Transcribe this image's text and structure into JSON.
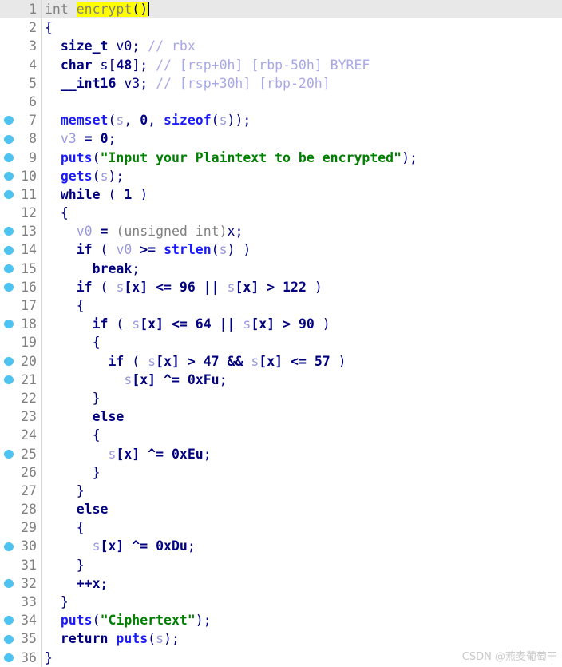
{
  "app": {
    "view": "pseudocode-decompiler",
    "function_name": "encrypt",
    "highlighted_identifier": "encrypt",
    "highlight_color": "#ffff00",
    "current_line_color": "#e8e8e8",
    "breakpoint_dot_color": "#4cc3f0",
    "gutter_divider_color": "#d8d8d8",
    "background_color": "#ffffff"
  },
  "watermark": {
    "text": "CSDN @燕麦葡萄干"
  },
  "colors": {
    "keyword": "#000080",
    "function": "#1a1aff",
    "variable": "#9a9ae0",
    "string": "#008000",
    "comment": "#a8a8e8",
    "cast_type": "#808080",
    "line_number": "#808080"
  },
  "editor": {
    "total_lines": 36,
    "current_line": 1,
    "breakpoint_lines": [
      7,
      8,
      9,
      10,
      11,
      13,
      14,
      15,
      16,
      18,
      20,
      21,
      25,
      30,
      32,
      34,
      35,
      36
    ],
    "lines": [
      {
        "n": "1",
        "dot": false,
        "current": true,
        "tokens": [
          {
            "t": "int ",
            "c": "t-type"
          },
          {
            "t": "encrypt",
            "c": "t-type t-hl"
          },
          {
            "t": "()",
            "c": "t-plain t-hl"
          },
          {
            "t": "",
            "c": "caret"
          }
        ]
      },
      {
        "n": "2",
        "dot": false,
        "tokens": [
          {
            "t": "{",
            "c": "t-plain"
          }
        ]
      },
      {
        "n": "3",
        "dot": false,
        "tokens": [
          {
            "t": "  ",
            "c": "t-plain"
          },
          {
            "t": "size_t",
            "c": "t-kw"
          },
          {
            "t": " v0; ",
            "c": "t-plain"
          },
          {
            "t": "// rbx",
            "c": "t-cmt"
          }
        ]
      },
      {
        "n": "4",
        "dot": false,
        "tokens": [
          {
            "t": "  ",
            "c": "t-plain"
          },
          {
            "t": "char",
            "c": "t-kw"
          },
          {
            "t": " s[",
            "c": "t-plain"
          },
          {
            "t": "48",
            "c": "t-num"
          },
          {
            "t": "]; ",
            "c": "t-plain"
          },
          {
            "t": "// [rsp+0h] [rbp-50h] BYREF",
            "c": "t-cmt"
          }
        ]
      },
      {
        "n": "5",
        "dot": false,
        "tokens": [
          {
            "t": "  ",
            "c": "t-plain"
          },
          {
            "t": "__int16",
            "c": "t-kw"
          },
          {
            "t": " v3; ",
            "c": "t-plain"
          },
          {
            "t": "// [rsp+30h] [rbp-20h]",
            "c": "t-cmt"
          }
        ]
      },
      {
        "n": "6",
        "dot": false,
        "tokens": [
          {
            "t": "",
            "c": "t-plain"
          }
        ]
      },
      {
        "n": "7",
        "dot": true,
        "tokens": [
          {
            "t": "  ",
            "c": "t-plain"
          },
          {
            "t": "memset",
            "c": "t-fn"
          },
          {
            "t": "(",
            "c": "t-plain"
          },
          {
            "t": "s",
            "c": "t-var"
          },
          {
            "t": ", ",
            "c": "t-plain"
          },
          {
            "t": "0",
            "c": "t-num"
          },
          {
            "t": ", ",
            "c": "t-plain"
          },
          {
            "t": "sizeof",
            "c": "t-fn"
          },
          {
            "t": "(",
            "c": "t-plain"
          },
          {
            "t": "s",
            "c": "t-var"
          },
          {
            "t": "));",
            "c": "t-plain"
          }
        ]
      },
      {
        "n": "8",
        "dot": true,
        "tokens": [
          {
            "t": "  ",
            "c": "t-plain"
          },
          {
            "t": "v3",
            "c": "t-var"
          },
          {
            "t": " = ",
            "c": "t-op"
          },
          {
            "t": "0",
            "c": "t-num"
          },
          {
            "t": ";",
            "c": "t-plain"
          }
        ]
      },
      {
        "n": "9",
        "dot": true,
        "tokens": [
          {
            "t": "  ",
            "c": "t-plain"
          },
          {
            "t": "puts",
            "c": "t-fn"
          },
          {
            "t": "(",
            "c": "t-plain"
          },
          {
            "t": "\"Input your Plaintext to be encrypted\"",
            "c": "t-str"
          },
          {
            "t": ");",
            "c": "t-plain"
          }
        ]
      },
      {
        "n": "10",
        "dot": true,
        "tokens": [
          {
            "t": "  ",
            "c": "t-plain"
          },
          {
            "t": "gets",
            "c": "t-fn"
          },
          {
            "t": "(",
            "c": "t-plain"
          },
          {
            "t": "s",
            "c": "t-var"
          },
          {
            "t": ");",
            "c": "t-plain"
          }
        ]
      },
      {
        "n": "11",
        "dot": true,
        "tokens": [
          {
            "t": "  ",
            "c": "t-plain"
          },
          {
            "t": "while",
            "c": "t-kw"
          },
          {
            "t": " ( ",
            "c": "t-plain"
          },
          {
            "t": "1",
            "c": "t-num"
          },
          {
            "t": " )",
            "c": "t-plain"
          }
        ]
      },
      {
        "n": "12",
        "dot": false,
        "tokens": [
          {
            "t": "  {",
            "c": "t-plain"
          }
        ]
      },
      {
        "n": "13",
        "dot": true,
        "tokens": [
          {
            "t": "    ",
            "c": "t-plain"
          },
          {
            "t": "v0",
            "c": "t-var"
          },
          {
            "t": " = ",
            "c": "t-op"
          },
          {
            "t": "(unsigned int)",
            "c": "t-type"
          },
          {
            "t": "x;",
            "c": "t-plain"
          }
        ]
      },
      {
        "n": "14",
        "dot": true,
        "tokens": [
          {
            "t": "    ",
            "c": "t-plain"
          },
          {
            "t": "if",
            "c": "t-kw"
          },
          {
            "t": " ( ",
            "c": "t-plain"
          },
          {
            "t": "v0",
            "c": "t-var"
          },
          {
            "t": " >= ",
            "c": "t-op"
          },
          {
            "t": "strlen",
            "c": "t-fn"
          },
          {
            "t": "(",
            "c": "t-plain"
          },
          {
            "t": "s",
            "c": "t-var"
          },
          {
            "t": ") )",
            "c": "t-plain"
          }
        ]
      },
      {
        "n": "15",
        "dot": true,
        "tokens": [
          {
            "t": "      ",
            "c": "t-plain"
          },
          {
            "t": "break",
            "c": "t-kw"
          },
          {
            "t": ";",
            "c": "t-plain"
          }
        ]
      },
      {
        "n": "16",
        "dot": true,
        "tokens": [
          {
            "t": "    ",
            "c": "t-plain"
          },
          {
            "t": "if",
            "c": "t-kw"
          },
          {
            "t": " ( ",
            "c": "t-plain"
          },
          {
            "t": "s",
            "c": "t-var"
          },
          {
            "t": "[x] <= ",
            "c": "t-op"
          },
          {
            "t": "96",
            "c": "t-num"
          },
          {
            "t": " || ",
            "c": "t-op"
          },
          {
            "t": "s",
            "c": "t-var"
          },
          {
            "t": "[x] > ",
            "c": "t-op"
          },
          {
            "t": "122",
            "c": "t-num"
          },
          {
            "t": " )",
            "c": "t-plain"
          }
        ]
      },
      {
        "n": "17",
        "dot": false,
        "tokens": [
          {
            "t": "    {",
            "c": "t-plain"
          }
        ]
      },
      {
        "n": "18",
        "dot": true,
        "tokens": [
          {
            "t": "      ",
            "c": "t-plain"
          },
          {
            "t": "if",
            "c": "t-kw"
          },
          {
            "t": " ( ",
            "c": "t-plain"
          },
          {
            "t": "s",
            "c": "t-var"
          },
          {
            "t": "[x] <= ",
            "c": "t-op"
          },
          {
            "t": "64",
            "c": "t-num"
          },
          {
            "t": " || ",
            "c": "t-op"
          },
          {
            "t": "s",
            "c": "t-var"
          },
          {
            "t": "[x] > ",
            "c": "t-op"
          },
          {
            "t": "90",
            "c": "t-num"
          },
          {
            "t": " )",
            "c": "t-plain"
          }
        ]
      },
      {
        "n": "19",
        "dot": false,
        "tokens": [
          {
            "t": "      {",
            "c": "t-plain"
          }
        ]
      },
      {
        "n": "20",
        "dot": true,
        "tokens": [
          {
            "t": "        ",
            "c": "t-plain"
          },
          {
            "t": "if",
            "c": "t-kw"
          },
          {
            "t": " ( ",
            "c": "t-plain"
          },
          {
            "t": "s",
            "c": "t-var"
          },
          {
            "t": "[x] > ",
            "c": "t-op"
          },
          {
            "t": "47",
            "c": "t-num"
          },
          {
            "t": " && ",
            "c": "t-op"
          },
          {
            "t": "s",
            "c": "t-var"
          },
          {
            "t": "[x] <= ",
            "c": "t-op"
          },
          {
            "t": "57",
            "c": "t-num"
          },
          {
            "t": " )",
            "c": "t-plain"
          }
        ]
      },
      {
        "n": "21",
        "dot": true,
        "tokens": [
          {
            "t": "          ",
            "c": "t-plain"
          },
          {
            "t": "s",
            "c": "t-var"
          },
          {
            "t": "[x] ^= ",
            "c": "t-op"
          },
          {
            "t": "0xFu",
            "c": "t-num"
          },
          {
            "t": ";",
            "c": "t-plain"
          }
        ]
      },
      {
        "n": "22",
        "dot": false,
        "tokens": [
          {
            "t": "      }",
            "c": "t-plain"
          }
        ]
      },
      {
        "n": "23",
        "dot": false,
        "tokens": [
          {
            "t": "      ",
            "c": "t-plain"
          },
          {
            "t": "else",
            "c": "t-kw"
          }
        ]
      },
      {
        "n": "24",
        "dot": false,
        "tokens": [
          {
            "t": "      {",
            "c": "t-plain"
          }
        ]
      },
      {
        "n": "25",
        "dot": true,
        "tokens": [
          {
            "t": "        ",
            "c": "t-plain"
          },
          {
            "t": "s",
            "c": "t-var"
          },
          {
            "t": "[x] ^= ",
            "c": "t-op"
          },
          {
            "t": "0xEu",
            "c": "t-num"
          },
          {
            "t": ";",
            "c": "t-plain"
          }
        ]
      },
      {
        "n": "26",
        "dot": false,
        "tokens": [
          {
            "t": "      }",
            "c": "t-plain"
          }
        ]
      },
      {
        "n": "27",
        "dot": false,
        "tokens": [
          {
            "t": "    }",
            "c": "t-plain"
          }
        ]
      },
      {
        "n": "28",
        "dot": false,
        "tokens": [
          {
            "t": "    ",
            "c": "t-plain"
          },
          {
            "t": "else",
            "c": "t-kw"
          }
        ]
      },
      {
        "n": "29",
        "dot": false,
        "tokens": [
          {
            "t": "    {",
            "c": "t-plain"
          }
        ]
      },
      {
        "n": "30",
        "dot": true,
        "tokens": [
          {
            "t": "      ",
            "c": "t-plain"
          },
          {
            "t": "s",
            "c": "t-var"
          },
          {
            "t": "[x] ^= ",
            "c": "t-op"
          },
          {
            "t": "0xDu",
            "c": "t-num"
          },
          {
            "t": ";",
            "c": "t-plain"
          }
        ]
      },
      {
        "n": "31",
        "dot": false,
        "tokens": [
          {
            "t": "    }",
            "c": "t-plain"
          }
        ]
      },
      {
        "n": "32",
        "dot": true,
        "tokens": [
          {
            "t": "    ++x;",
            "c": "t-op"
          }
        ]
      },
      {
        "n": "33",
        "dot": false,
        "tokens": [
          {
            "t": "  }",
            "c": "t-plain"
          }
        ]
      },
      {
        "n": "34",
        "dot": true,
        "tokens": [
          {
            "t": "  ",
            "c": "t-plain"
          },
          {
            "t": "puts",
            "c": "t-fn"
          },
          {
            "t": "(",
            "c": "t-plain"
          },
          {
            "t": "\"Ciphertext\"",
            "c": "t-str"
          },
          {
            "t": ");",
            "c": "t-plain"
          }
        ]
      },
      {
        "n": "35",
        "dot": true,
        "tokens": [
          {
            "t": "  ",
            "c": "t-plain"
          },
          {
            "t": "return",
            "c": "t-kw"
          },
          {
            "t": " ",
            "c": "t-plain"
          },
          {
            "t": "puts",
            "c": "t-fn"
          },
          {
            "t": "(",
            "c": "t-plain"
          },
          {
            "t": "s",
            "c": "t-var"
          },
          {
            "t": ");",
            "c": "t-plain"
          }
        ]
      },
      {
        "n": "36",
        "dot": true,
        "tokens": [
          {
            "t": "}",
            "c": "t-plain"
          }
        ]
      }
    ]
  }
}
